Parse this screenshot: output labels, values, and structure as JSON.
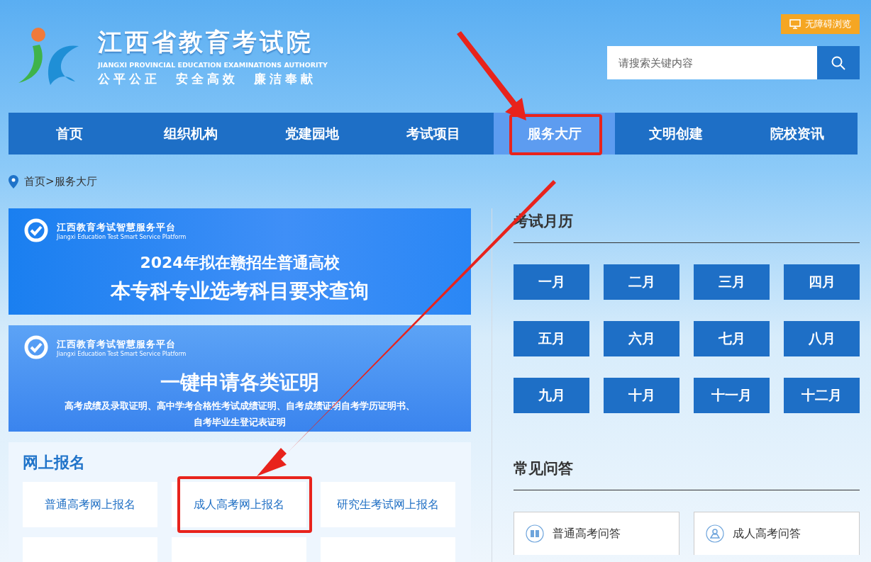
{
  "header": {
    "site_title": "江西省教育考试院",
    "site_subtitle": "JIANGXI PROVINCIAL EDUCATION EXAMINATIONS AUTHORITY",
    "motto": "公平公正  安全高效  廉洁奉献",
    "accessibility_button": "无障碍浏览",
    "search": {
      "placeholder": "请搜索关键内容"
    }
  },
  "nav": [
    {
      "label": "首页",
      "selected": false,
      "highlighted": false
    },
    {
      "label": "组织机构",
      "selected": false,
      "highlighted": false
    },
    {
      "label": "党建园地",
      "selected": false,
      "highlighted": false
    },
    {
      "label": "考试项目",
      "selected": false,
      "highlighted": false
    },
    {
      "label": "服务大厅",
      "selected": true,
      "highlighted": true
    },
    {
      "label": "文明创建",
      "selected": false,
      "highlighted": false
    },
    {
      "label": "院校资讯",
      "selected": false,
      "highlighted": false
    }
  ],
  "breadcrumb": "首页>服务大厅",
  "banners": [
    {
      "kind": "query",
      "platform_cn": "江西教育考试智慧服务平台",
      "platform_en": "Jiangxi Education Test Smart Service Platform",
      "lines": [
        "2024年拟在赣招生普通高校",
        "本专科专业选考科目要求查询"
      ]
    },
    {
      "kind": "certificate",
      "platform_cn": "江西教育考试智慧服务平台",
      "platform_en": "Jiangxi Education Test Smart Service Platform",
      "lines": [
        "一键申请各类证明",
        "高考成绩及录取证明、高中学考合格性考试成绩证明、自考成绩证明自考学历证明书、",
        "自考毕业生登记表证明"
      ]
    }
  ],
  "online_registration": {
    "title": "网上报名",
    "items": [
      {
        "label": "普通高考网上报名",
        "highlighted": false
      },
      {
        "label": "成人高考网上报名",
        "highlighted": true
      },
      {
        "label": "研究生考试网上报名",
        "highlighted": false
      }
    ]
  },
  "exam_calendar": {
    "title": "考试月历",
    "months": [
      "一月",
      "二月",
      "三月",
      "四月",
      "五月",
      "六月",
      "七月",
      "八月",
      "九月",
      "十月",
      "十一月",
      "十二月"
    ]
  },
  "faq": {
    "title": "常见问答",
    "items": [
      {
        "label": "普通高考问答",
        "kind": "book"
      },
      {
        "label": "成人高考问答",
        "kind": "person"
      }
    ]
  }
}
